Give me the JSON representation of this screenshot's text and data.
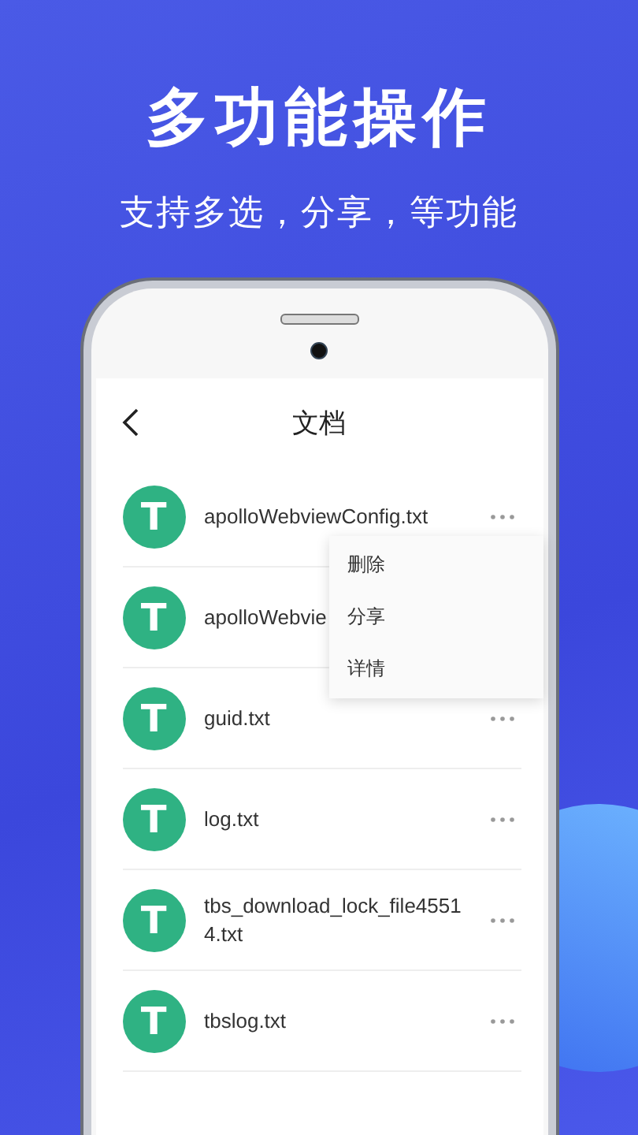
{
  "headline": "多功能操作",
  "subtitle": "支持多选，分享，等功能",
  "screen": {
    "title": "文档",
    "files": [
      {
        "icon_letter": "T",
        "name": "apolloWebviewConfig.txt"
      },
      {
        "icon_letter": "T",
        "name": "apolloWebvie"
      },
      {
        "icon_letter": "T",
        "name": "guid.txt"
      },
      {
        "icon_letter": "T",
        "name": "log.txt"
      },
      {
        "icon_letter": "T",
        "name": "tbs_download_lock_file45514.txt"
      },
      {
        "icon_letter": "T",
        "name": "tbslog.txt"
      }
    ],
    "menu": [
      "删除",
      "分享",
      "详情"
    ]
  }
}
